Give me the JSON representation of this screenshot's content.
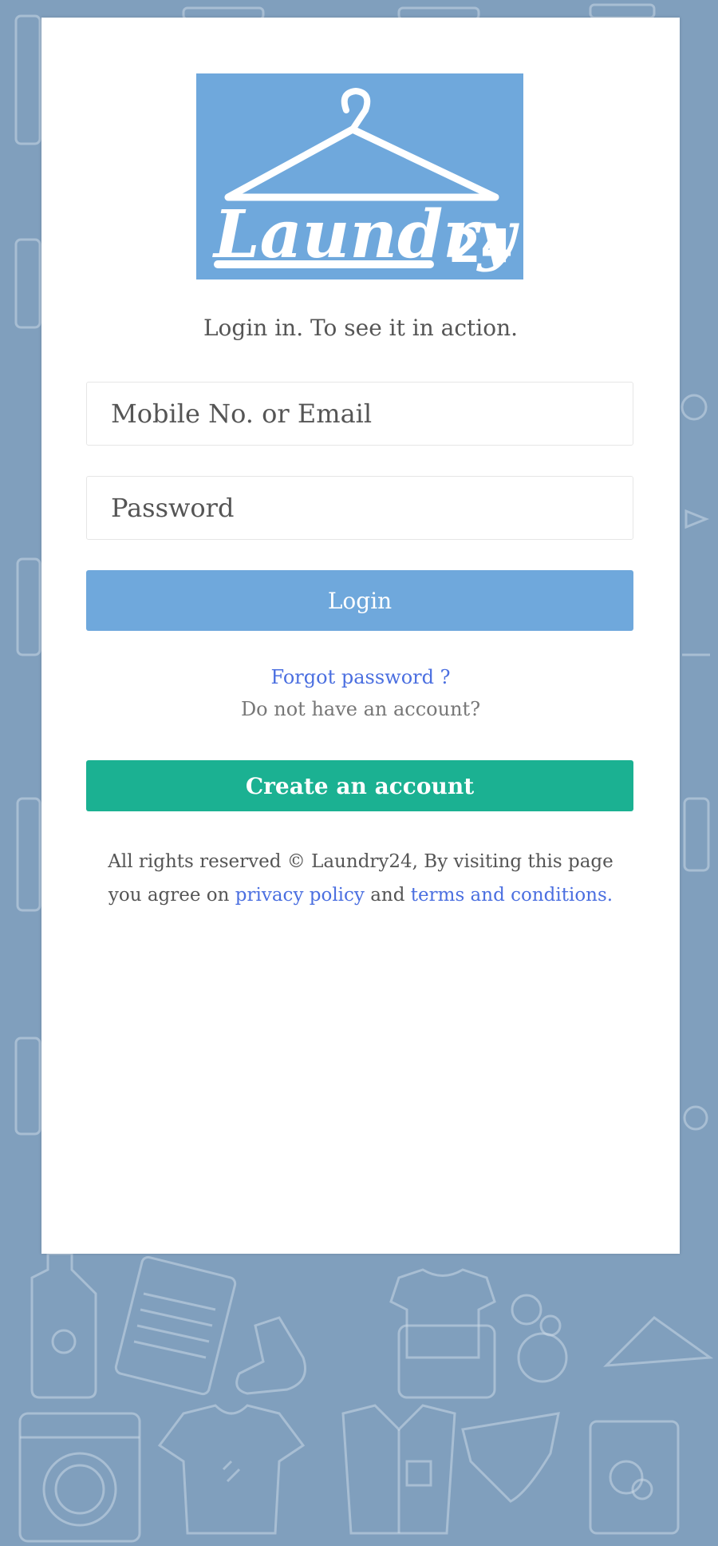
{
  "brand": {
    "name": "Laundry",
    "number": "24",
    "logo_bg": "#6fa8dc"
  },
  "colors": {
    "page_bg": "#809fbd",
    "primary": "#6fa8dc",
    "success": "#1bb192",
    "link": "#4b6fe0"
  },
  "login": {
    "tagline": "Login in. To see it in action.",
    "email_placeholder": "Mobile No. or Email",
    "password_placeholder": "Password",
    "login_button": "Login",
    "forgot_password": "Forgot password ?",
    "no_account": "Do not have an account?",
    "create_account_button": "Create an account"
  },
  "footer": {
    "text_line1": "All rights reserved © Laundry24, By visiting this page",
    "text_prefix": "you agree on",
    "privacy_link": "privacy policy",
    "and_text": "and",
    "terms_link": "terms and conditions."
  },
  "background_icons": [
    "spray-bottle-icon",
    "ironing-board-icon",
    "sock-icon",
    "tshirt-icon",
    "bubbles-icon",
    "hanger-icon",
    "washing-machine-icon",
    "shirt-icon",
    "detergent-icon"
  ]
}
